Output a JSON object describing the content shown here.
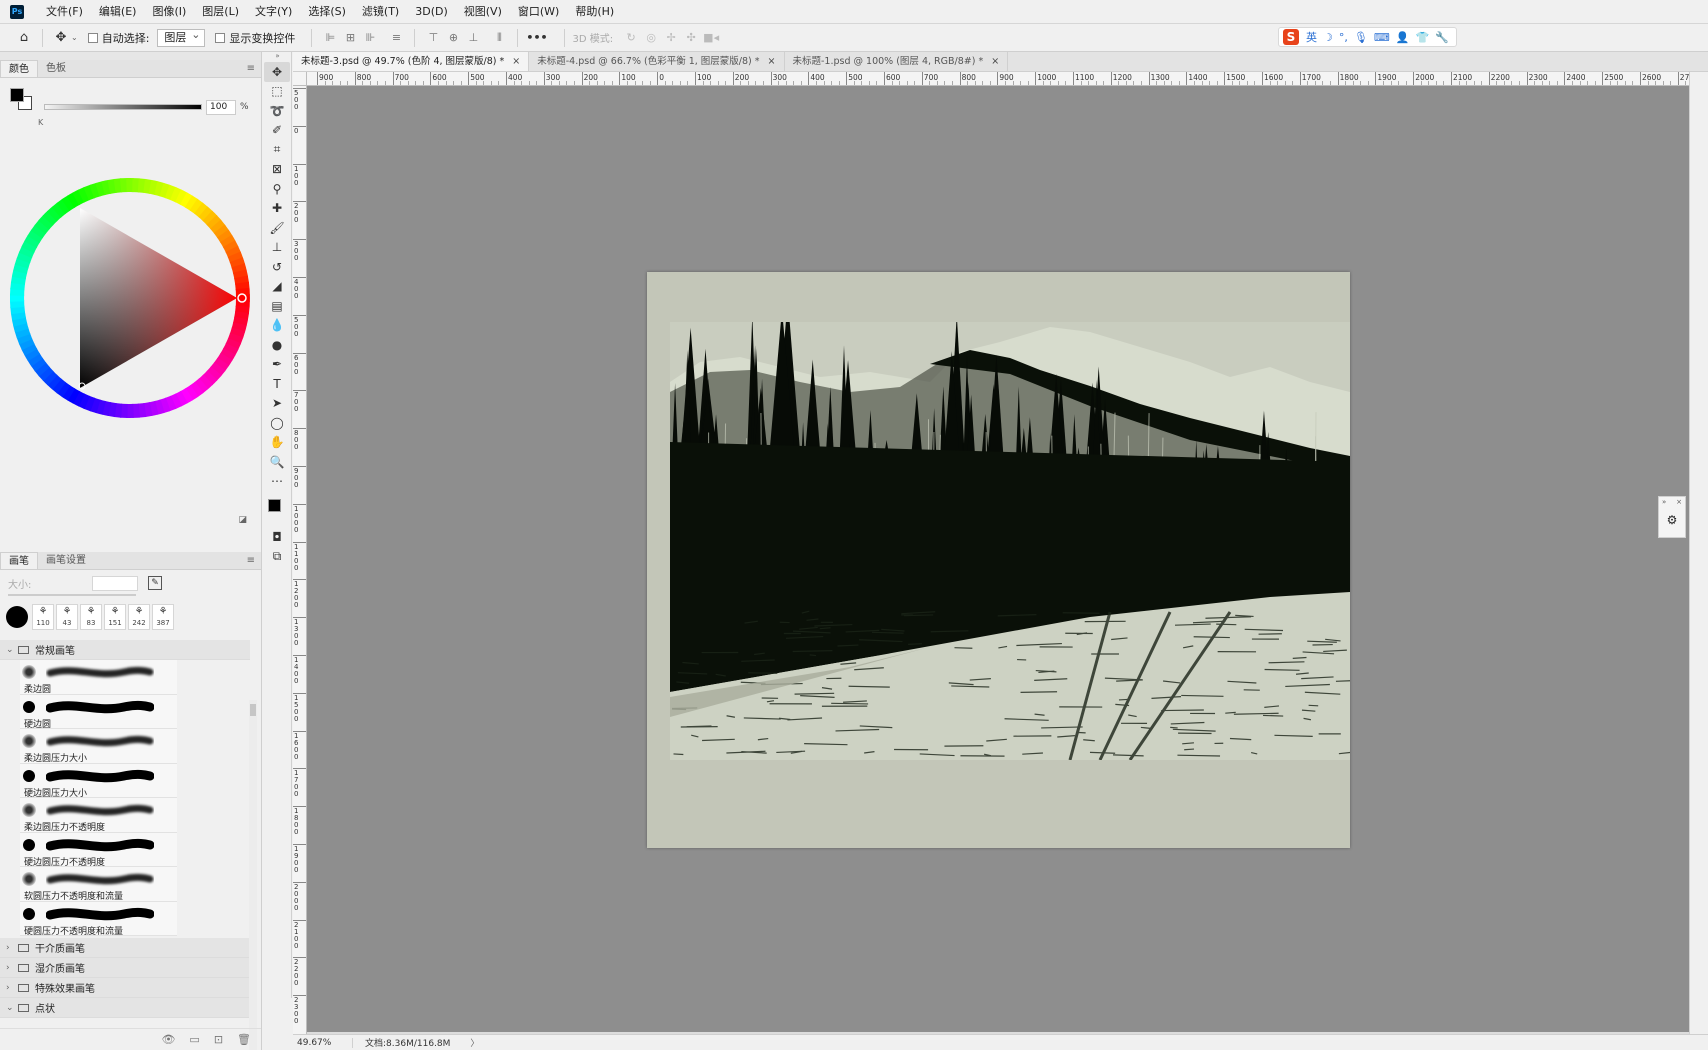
{
  "app": {
    "logo": "Ps"
  },
  "menu": [
    "文件(F)",
    "编辑(E)",
    "图像(I)",
    "图层(L)",
    "文字(Y)",
    "选择(S)",
    "滤镜(T)",
    "3D(D)",
    "视图(V)",
    "窗口(W)",
    "帮助(H)"
  ],
  "options": {
    "auto_select_label": "自动选择:",
    "auto_select_value": "图层",
    "show_transform_label": "显示变换控件",
    "mode_3d_label": "3D 模式:",
    "more": "•••"
  },
  "ime": {
    "logo": "S",
    "lang": "英",
    "items": [
      "☽",
      "°,",
      "🎙",
      "⌨",
      "👤",
      "👕",
      "🔧"
    ]
  },
  "color_panel": {
    "tabs": [
      "颜色",
      "色板"
    ],
    "k_label": "K",
    "k_value": "100",
    "k_unit": "%",
    "hue": "red"
  },
  "brush_panel": {
    "tabs": [
      "画笔",
      "画笔设置"
    ],
    "size_label": "大小:",
    "presets": [
      {
        "num": "110"
      },
      {
        "num": "43"
      },
      {
        "num": "83"
      },
      {
        "num": "151"
      },
      {
        "num": "242"
      },
      {
        "num": "387"
      }
    ],
    "groups": {
      "general": "常规画笔",
      "dry": "干介质画笔",
      "wet": "湿介质画笔",
      "special": "特殊效果画笔",
      "dots": "点状"
    },
    "brushes": [
      {
        "name": "柔边圆",
        "soft": true
      },
      {
        "name": "硬边圆",
        "soft": false
      },
      {
        "name": "柔边圆压力大小",
        "soft": true
      },
      {
        "name": "硬边圆压力大小",
        "soft": false
      },
      {
        "name": "柔边圆压力不透明度",
        "soft": true
      },
      {
        "name": "硬边圆压力不透明度",
        "soft": false
      },
      {
        "name": "软圆压力不透明度和流量",
        "soft": true
      },
      {
        "name": "硬圆压力不透明度和流量",
        "soft": false
      }
    ]
  },
  "tabs": [
    {
      "title": "未标题-3.psd @ 49.7% (色阶 4, 图层蒙版/8) *",
      "close": "×",
      "active": true
    },
    {
      "title": "未标题-4.psd @ 66.7% (色彩平衡 1, 图层蒙版/8) *",
      "close": "×",
      "active": false
    },
    {
      "title": "未标题-1.psd @ 100% (图层 4, RGB/8#) *",
      "close": "×",
      "active": false
    }
  ],
  "ruler_h": [
    "900",
    "800",
    "700",
    "600",
    "500",
    "400",
    "300",
    "200",
    "100",
    "0",
    "100",
    "200",
    "300",
    "400",
    "500",
    "600",
    "700",
    "800",
    "900",
    "1000",
    "1100",
    "1200",
    "1300",
    "1400",
    "1500",
    "1600",
    "1700",
    "1800",
    "1900",
    "2000",
    "2100",
    "2200",
    "2300",
    "2400",
    "2500",
    "2600",
    "2700"
  ],
  "ruler_v": [
    "500",
    "0",
    "100",
    "200",
    "300",
    "400",
    "500",
    "600",
    "700",
    "800",
    "900",
    "1000",
    "1100",
    "1200",
    "1300",
    "1400",
    "1500",
    "1600",
    "1700",
    "1800",
    "1900",
    "2000",
    "2100",
    "2200",
    "2300"
  ],
  "status": {
    "zoom": "49.67%",
    "doc_info": "文档:8.36M/116.8M",
    "arrow": "〉"
  },
  "right_panel": {
    "collapse": "»",
    "close": "×"
  },
  "colors": {
    "canvas_bg": "#8e8e8e",
    "artboard": "#c3c6b8",
    "photo_light": "#d7dccd",
    "photo_dark": "#0a1008",
    "ime_brand": "#e8431b"
  }
}
